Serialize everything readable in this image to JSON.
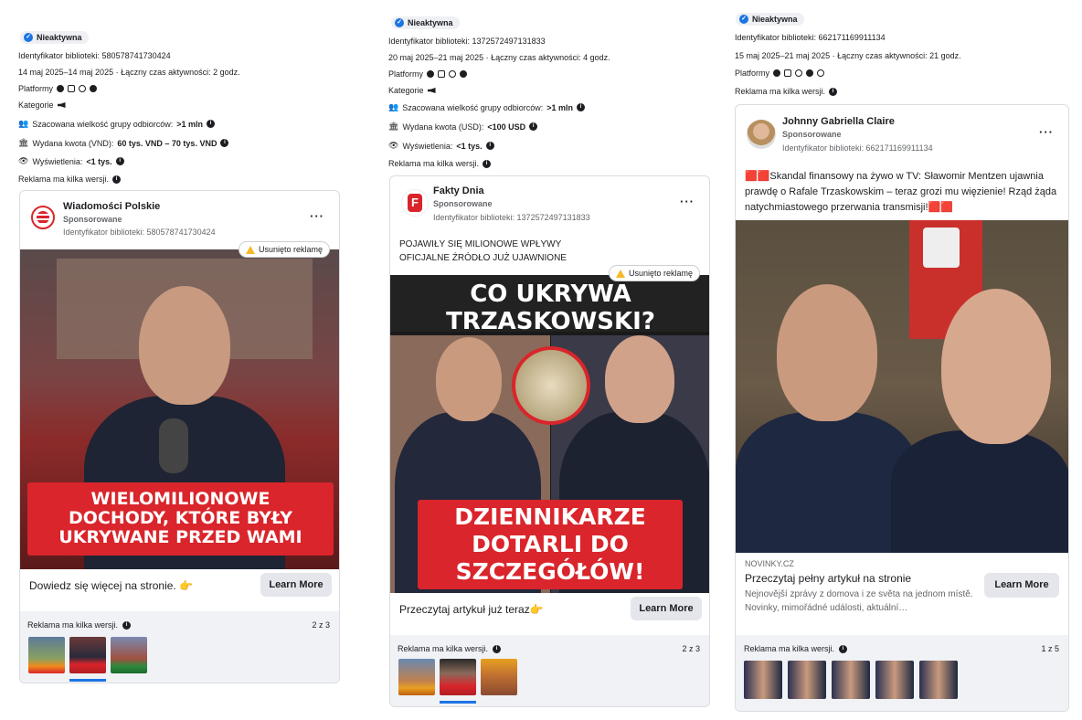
{
  "panels": [
    {
      "status": "Nieaktywna",
      "library_id_label": "Identyfikator biblioteki: 580578741730424",
      "dates": "14 maj 2025–14 maj 2025 · Łączny czas aktywności: 2 godz.",
      "platforms_label": "Platformy",
      "categories_label": "Kategorie",
      "audience_label": "Szacowana wielkość grupy odbiorców:",
      "audience_value": ">1 mln",
      "spend_label": "Wydana kwota (VND):",
      "spend_value": "60 tys. VND – 70 tys. VND",
      "views_label": "Wyświetlenia:",
      "views_value": "<1 tys.",
      "versions_note": "Reklama ma kilka wersji.",
      "page_name": "Wiadomości Polskie",
      "sponsored": "Sponsorowane",
      "card_library_id": "Identyfikator biblioteki: 580578741730424",
      "removed_label": "Usunięto reklamę",
      "headline": [
        "WIELOMILIONOWE",
        "DOCHODY, KTÓRE BYŁY",
        "UKRYWANE PRZED WAMI"
      ],
      "cta_text": "Dowiedz się więcej na stronie. 👉",
      "learn_more": "Learn More",
      "footer_label": "Reklama ma kilka wersji.",
      "footer_count": "2 z 3"
    },
    {
      "status": "Nieaktywna",
      "library_id_label": "Identyfikator biblioteki: 1372572497131833",
      "dates": "20 maj 2025–21 maj 2025 · Łączny czas aktywności: 4 godz.",
      "platforms_label": "Platformy",
      "categories_label": "Kategorie",
      "audience_label": "Szacowana wielkość grupy odbiorców:",
      "audience_value": ">1 mln",
      "spend_label": "Wydana kwota (USD):",
      "spend_value": "<100 USD",
      "views_label": "Wyświetlenia:",
      "views_value": "<1 tys.",
      "versions_note": "Reklama ma kilka wersji.",
      "page_name": "Fakty Dnia",
      "sponsored": "Sponsorowane",
      "card_library_id": "Identyfikator biblioteki: 1372572497131833",
      "body_line1": "POJAWIŁY SIĘ MILIONOWE WPŁYWY",
      "body_line2": "OFICJALNE ŹRÓDŁO JUŻ UJAWNIONE",
      "removed_label": "Usunięto reklamę",
      "headline_top": [
        "CO UKRYWA",
        "TRZASKOWSKI?"
      ],
      "headline_bottom": [
        "DZIENNIKARZE",
        "DOTARLI DO",
        "SZCZEGÓŁÓW!"
      ],
      "cta_text": "Przeczytaj artykuł już teraz👉",
      "learn_more": "Learn More",
      "footer_label": "Reklama ma kilka wersji.",
      "footer_count": "2 z 3"
    },
    {
      "status": "Nieaktywna",
      "library_id_label": "Identyfikator biblioteki: 662171169911134",
      "dates": "15 maj 2025–21 maj 2025 · Łączny czas aktywności: 21 godz.",
      "platforms_label": "Platformy",
      "versions_note": "Reklama ma kilka wersji.",
      "page_name": "Johnny Gabriella Claire",
      "sponsored": "Sponsorowane",
      "card_library_id": "Identyfikator biblioteki: 662171169911134",
      "body": "🟥🟥Skandal finansowy na żywo w TV: Sławomir Mentzen ujawnia prawdę o Rafale Trzaskowskim – teraz grozi mu więzienie! Rząd żąda natychmiastowego przerwania transmisji!🟥🟥",
      "domain": "NOVINKY.CZ",
      "link_title": "Przeczytaj pełny artykuł na stronie",
      "link_desc": "Nejnovější zprávy z domova i ze světa na jednom místě. Novinky, mimořádné události, aktuální…",
      "learn_more": "Learn More",
      "footer_label": "Reklama ma kilka wersji.",
      "footer_count": "1 z 5"
    }
  ],
  "icons": {
    "info": "info-icon",
    "facebook": "facebook-icon",
    "instagram": "instagram-icon",
    "audience_network": "audience-network-icon",
    "messenger": "messenger-icon",
    "threads": "threads-icon",
    "megaphone": "megaphone-icon",
    "people": "people-icon",
    "money": "money-icon",
    "eye": "eye-icon",
    "warning": "warning-icon"
  },
  "colors": {
    "accent": "#1b74e4",
    "banner_red": "#d9252b",
    "warning": "#f7b928"
  }
}
